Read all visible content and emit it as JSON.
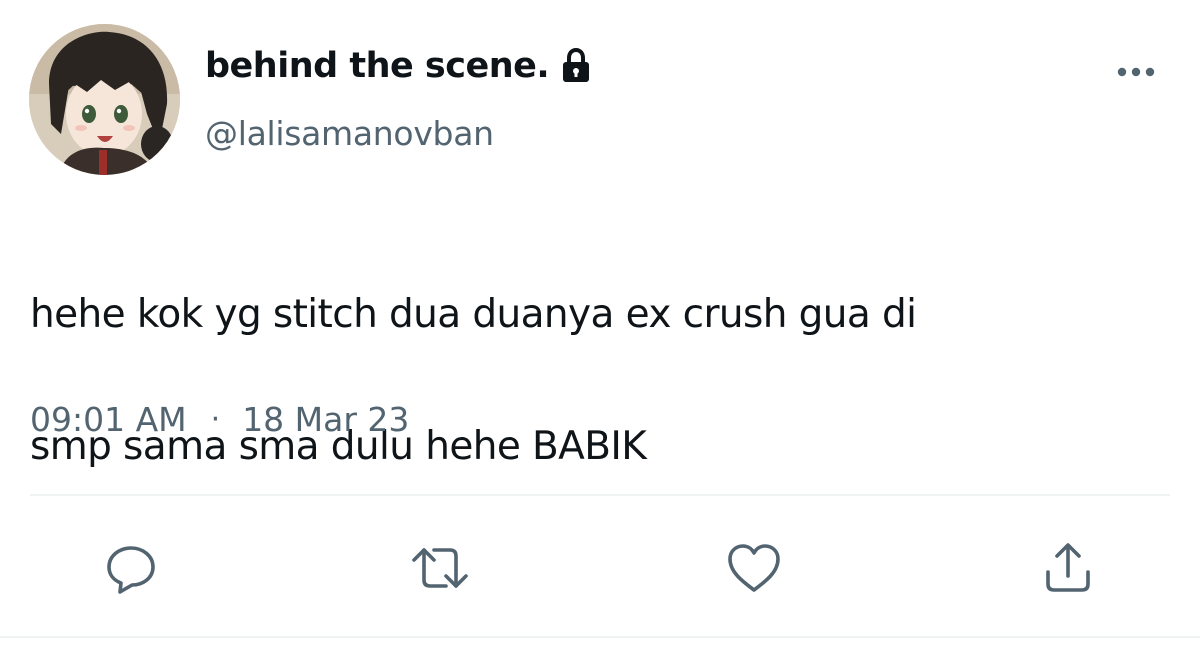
{
  "user": {
    "display_name": "behind the scene.",
    "handle": "@lalisamanovban"
  },
  "tweet": {
    "text_line1": "hehe kok yg stitch dua duanya ex crush gua di",
    "text_line2": "smp sama sma dulu hehe BABIK",
    "time": "09:01 AM",
    "separator": "·",
    "date": "18 Mar 23"
  },
  "icons": {
    "lock": "lock-icon",
    "more": "more-icon",
    "reply": "reply-icon",
    "retweet": "retweet-icon",
    "like": "heart-icon",
    "share": "share-icon"
  },
  "colors": {
    "text": "#0f1419",
    "secondary": "#536471",
    "divider": "#eff3f4"
  }
}
